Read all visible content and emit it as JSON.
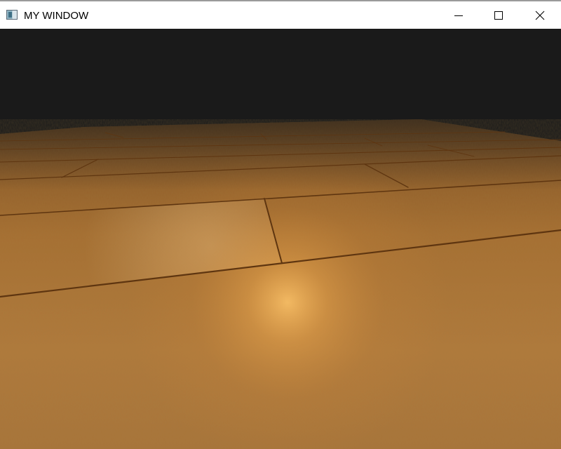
{
  "window": {
    "title": "MY WINDOW",
    "icon": "app-window-icon",
    "controls": {
      "minimize_icon": "minimize-icon",
      "maximize_icon": "maximize-icon",
      "close_icon": "close-icon"
    }
  },
  "scene": {
    "background_color": "#1a1a1a",
    "floor_base_color": "#b9813c",
    "floor_dark_color": "#7a4f1f",
    "light_color": "#ffc56a",
    "seam_color": "#5e3510"
  }
}
